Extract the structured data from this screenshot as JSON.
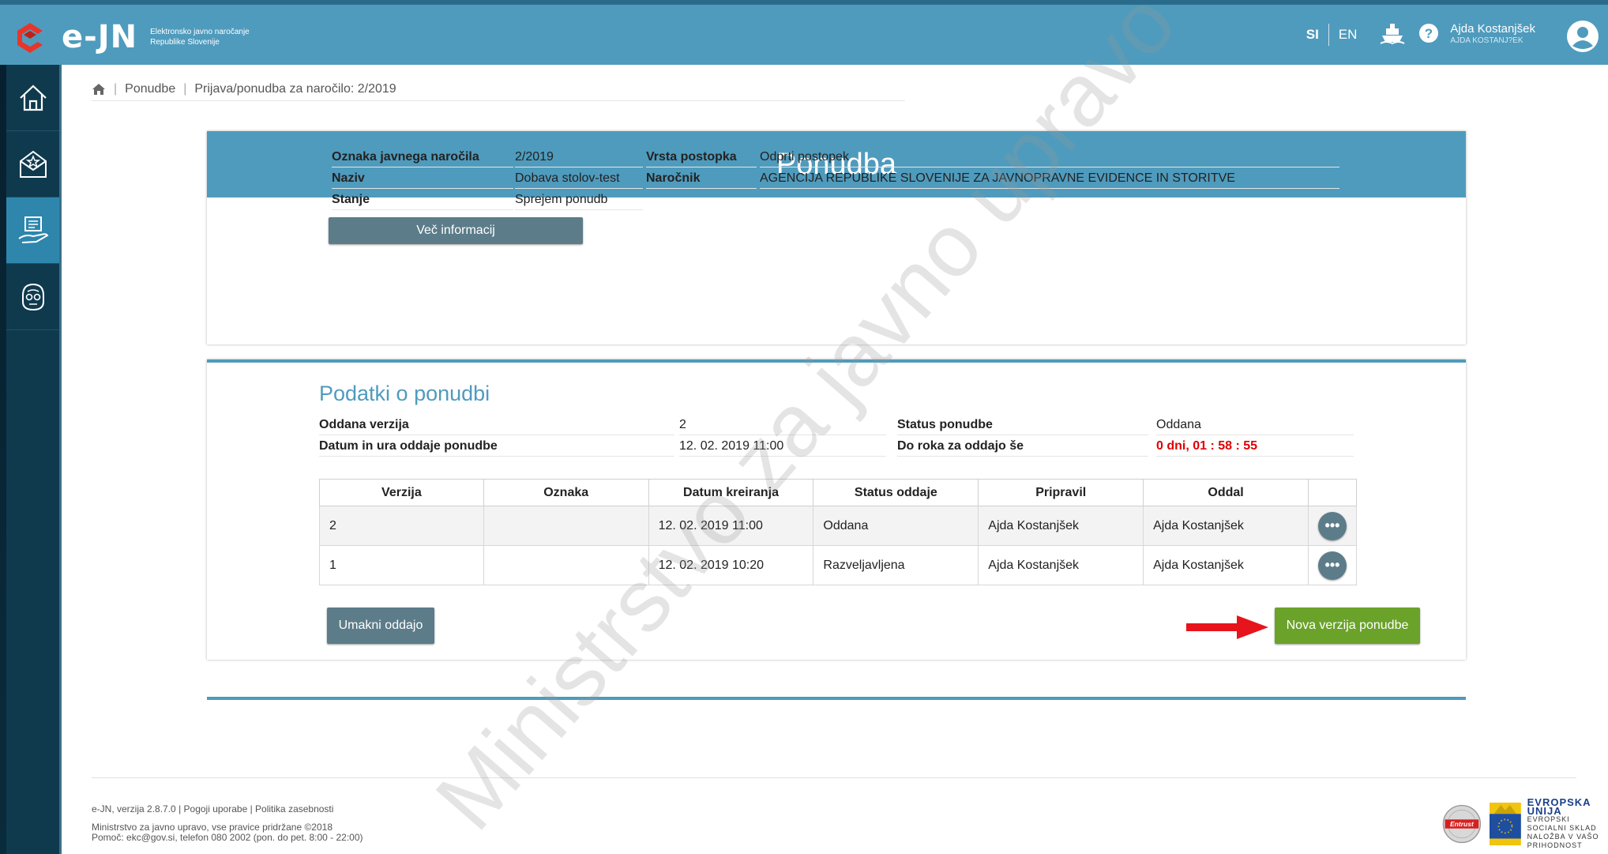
{
  "header": {
    "logo_text": "e-JN",
    "logo_sub1": "Elektronsko javno naročanje",
    "logo_sub2": "Republike Slovenije",
    "lang_si": "SI",
    "lang_en": "EN",
    "user_name": "Ajda Kostanjšek",
    "user_sub": "AJDA KOSTANJ?EK"
  },
  "sidebar": {
    "items": [
      {
        "icon": "home-icon",
        "active": false
      },
      {
        "icon": "envelope-star-icon",
        "active": false
      },
      {
        "icon": "hand-document-icon",
        "active": true
      },
      {
        "icon": "support-head-icon",
        "active": false
      }
    ]
  },
  "breadcrumb": {
    "item1": "Ponudbe",
    "item2": "Prijava/ponudba za naročilo: 2/2019"
  },
  "offer": {
    "title": "Ponudba",
    "l_oznaka": "Oznaka javnega naročila",
    "v_oznaka": "2/2019",
    "l_naziv": "Naziv",
    "v_naziv": "Dobava stolov-test",
    "l_stanje": "Stanje",
    "v_stanje": "Sprejem ponudb",
    "l_vrsta": "Vrsta postopka",
    "v_vrsta": "Odprti postopek",
    "l_narocnik": "Naročnik",
    "v_narocnik": "AGENCIJA REPUBLIKE SLOVENIJE ZA JAVNOPRAVNE EVIDENCE IN STORITVE",
    "more_button": "Več informacij"
  },
  "details": {
    "title": "Podatki o ponudbi",
    "l_verzija": "Oddana verzija",
    "v_verzija": "2",
    "l_datum": "Datum in ura oddaje ponudbe",
    "v_datum": "12. 02. 2019 11:00",
    "l_status": "Status ponudbe",
    "v_status": "Oddana",
    "l_rok": "Do roka za oddajo še",
    "v_rok": "0 dni, 01 : 58 : 55",
    "deadline_color": "#e00000",
    "table": {
      "headers": [
        "Verzija",
        "Oznaka",
        "Datum kreiranja",
        "Status oddaje",
        "Pripravil",
        "Oddal"
      ],
      "rows": [
        [
          "2",
          "",
          "12. 02. 2019 11:00",
          "Oddana",
          "Ajda Kostanjšek",
          "Ajda Kostanjšek"
        ],
        [
          "1",
          "",
          "12. 02. 2019 10:20",
          "Razveljavljena",
          "Ajda Kostanjšek",
          "Ajda Kostanjšek"
        ]
      ]
    },
    "withdraw_button": "Umakni oddajo",
    "new_version_button": "Nova verzija ponudbe"
  },
  "footer": {
    "version": "e-JN, verzija 2.8.7.0",
    "terms": "Pogoji uporabe",
    "privacy": "Politika zasebnosti",
    "copyright": "Ministrstvo za javno upravo, vse pravice pridržane ©2018",
    "help": "Pomoč: ekc@gov.si, telefon 080 2002 (pon. do pet. 8:00 - 22:00)",
    "eu_title": "EVROPSKA UNIJA",
    "eu_sub1": "EVROPSKI",
    "eu_sub2": "SOCIALNI SKLAD",
    "eu_sub3": "NALOŽBA V VAŠO PRIHODNOST",
    "entrust": "Entrust"
  },
  "watermark": "Ministrstvo za javno upravo",
  "colors": {
    "brand": "#4f9bbd",
    "sidebar": "#0f3a4e",
    "green": "#6aa22a",
    "button_gray": "#5c7c89",
    "deadline": "#e00000",
    "arrow": "#e8141b"
  }
}
